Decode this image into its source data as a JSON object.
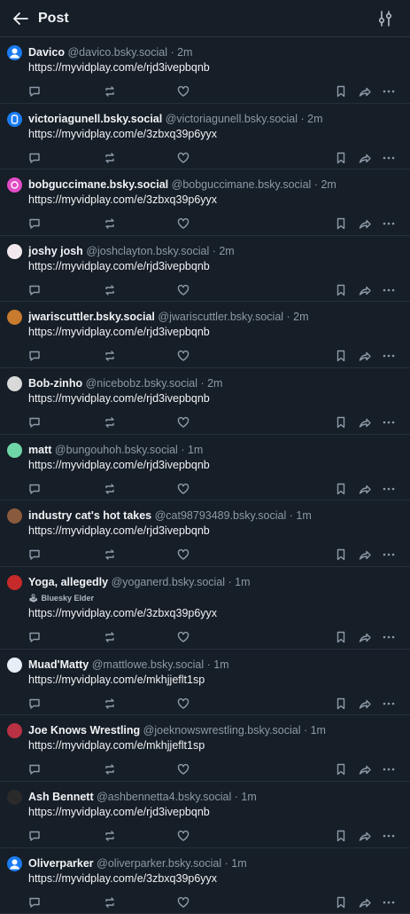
{
  "header": {
    "title": "Post"
  },
  "replies": [
    {
      "name": "Davico",
      "handle": "@davico.bsky.social",
      "time": "· 2m",
      "text": "https://myvidplay.com/e/rjd3ivepbqnb",
      "avatar": "#1a7bf0",
      "avatar_type": "person"
    },
    {
      "name": "victoriagunell.bsky.social",
      "handle": "@victoriagunell.bsky.social",
      "time": "· 2m",
      "text": "https://myvidplay.com/e/3zbxq39p6yyx",
      "avatar": "#1a7bf0",
      "avatar_type": "blank"
    },
    {
      "name": "bobguccimane.bsky.social",
      "handle": "@bobguccimane.bsky.social",
      "time": "· 2m",
      "text": "https://myvidplay.com/e/3zbxq39p6yyx",
      "avatar": "#e24cc6",
      "avatar_type": "at"
    },
    {
      "name": "joshy josh",
      "handle": "@joshclayton.bsky.social",
      "time": "· 2m",
      "text": "https://myvidplay.com/e/rjd3ivepbqnb",
      "avatar": "#f2e9ef",
      "avatar_type": "pic"
    },
    {
      "name": "jwariscuttler.bsky.social",
      "handle": "@jwariscuttler.bsky.social",
      "time": "· 2m",
      "text": "https://myvidplay.com/e/rjd3ivepbqnb",
      "avatar": "#c87a2e",
      "avatar_type": "pic"
    },
    {
      "name": "Bob-zinho",
      "handle": "@nicebobz.bsky.social",
      "time": "· 2m",
      "text": "https://myvidplay.com/e/rjd3ivepbqnb",
      "avatar": "#d9d9d9",
      "avatar_type": "pic"
    },
    {
      "name": "matt",
      "handle": "@bungouhoh.bsky.social",
      "time": "· 1m",
      "text": "https://myvidplay.com/e/rjd3ivepbqnb",
      "avatar": "#6fd6a8",
      "avatar_type": "pic"
    },
    {
      "name": "industry cat's hot takes",
      "handle": "@cat98793489.bsky.social",
      "time": "· 1m",
      "text": "https://myvidplay.com/e/rjd3ivepbqnb",
      "avatar": "#8a5a3c",
      "avatar_type": "pic"
    },
    {
      "name": "Yoga, allegedly",
      "handle": "@yoganerd.bsky.social",
      "time": "· 1m",
      "text": "https://myvidplay.com/e/3zbxq39p6yyx",
      "avatar": "#c62a2a",
      "avatar_type": "pic",
      "badge": "Bluesky Elder"
    },
    {
      "name": "Muad'Matty",
      "handle": "@mattlowe.bsky.social",
      "time": "· 1m",
      "text": "https://myvidplay.com/e/mkhjjeflt1sp",
      "avatar": "#e8eef5",
      "avatar_type": "pic"
    },
    {
      "name": "Joe Knows Wrestling",
      "handle": "@joeknowswrestling.bsky.social",
      "time": "· 1m",
      "text": "https://myvidplay.com/e/mkhjjeflt1sp",
      "avatar": "#b83244",
      "avatar_type": "pic"
    },
    {
      "name": "Ash Bennett",
      "handle": "@ashbennetta4.bsky.social",
      "time": "· 1m",
      "text": "https://myvidplay.com/e/rjd3ivepbqnb",
      "avatar": "#2a2a2a",
      "avatar_type": "pic"
    },
    {
      "name": "Oliverparker",
      "handle": "@oliverparker.bsky.social",
      "time": "· 1m",
      "text": "https://myvidplay.com/e/3zbxq39p6yyx",
      "avatar": "#1a7bf0",
      "avatar_type": "person"
    }
  ]
}
